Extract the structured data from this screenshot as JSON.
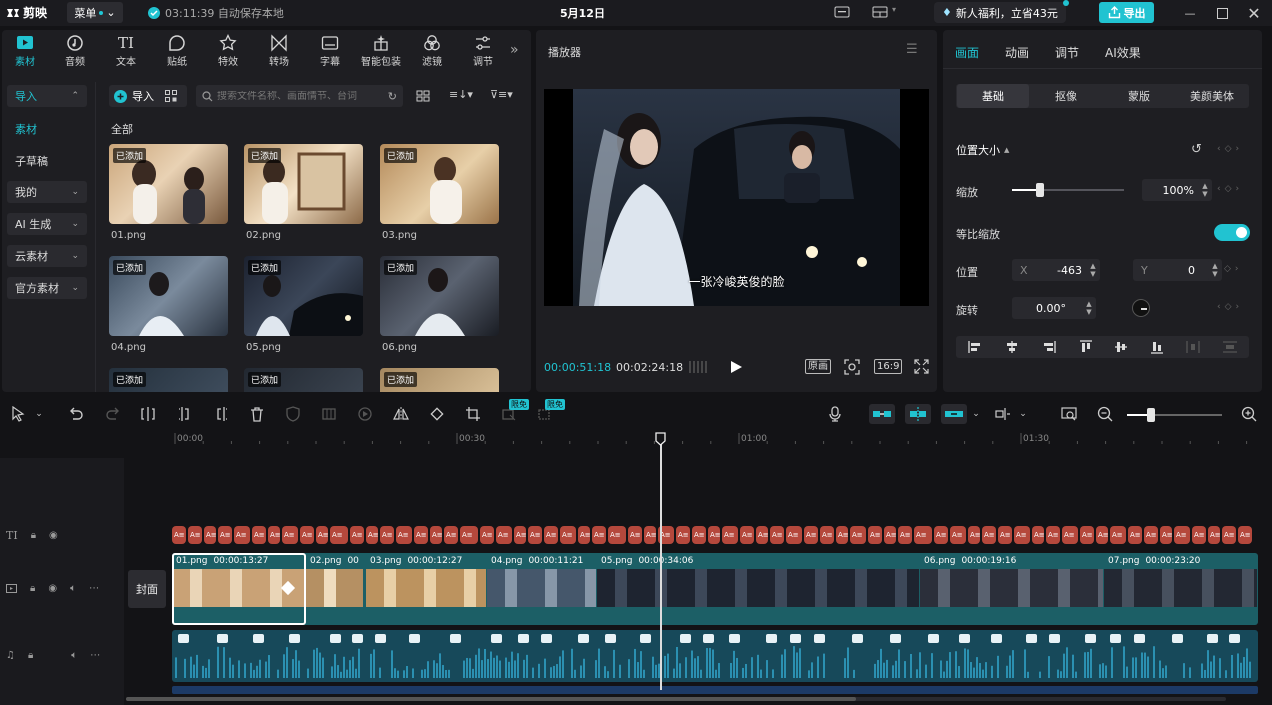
{
  "app": {
    "name": "剪映",
    "menu_label": "菜单",
    "save_status": "03:11:39 自动保存本地",
    "date": "5月12日",
    "promo": "新人福利，立省43元",
    "export_label": "导出"
  },
  "colors": {
    "accent": "#21c3d1",
    "text_clip": "#b5483c",
    "video_track": "#1c5f66",
    "audio_track": "#17495a"
  },
  "tools": [
    {
      "label": "素材",
      "icon": "media-icon"
    },
    {
      "label": "音频",
      "icon": "audio-icon"
    },
    {
      "label": "文本",
      "icon": "text-icon"
    },
    {
      "label": "贴纸",
      "icon": "sticker-icon"
    },
    {
      "label": "特效",
      "icon": "effects-icon"
    },
    {
      "label": "转场",
      "icon": "transition-icon"
    },
    {
      "label": "字幕",
      "icon": "subtitle-icon"
    },
    {
      "label": "智能包装",
      "icon": "smart-pack-icon"
    },
    {
      "label": "滤镜",
      "icon": "filter-icon"
    },
    {
      "label": "调节",
      "icon": "adjust-icon"
    }
  ],
  "left_nav": [
    {
      "label": "导入",
      "type": "box-active"
    },
    {
      "label": "素材",
      "type": "selected"
    },
    {
      "label": "子草稿",
      "type": "plain"
    },
    {
      "label": "我的",
      "type": "box"
    },
    {
      "label": "AI 生成",
      "type": "box"
    },
    {
      "label": "云素材",
      "type": "box"
    },
    {
      "label": "官方素材",
      "type": "box"
    }
  ],
  "media": {
    "import_label": "导入",
    "search_placeholder": "搜索文件名称、画面情节、台词",
    "section_title": "全部",
    "added_tag": "已添加",
    "items": [
      "01.png",
      "02.png",
      "03.png",
      "04.png",
      "05.png",
      "06.png"
    ]
  },
  "player": {
    "title": "播放器",
    "subtitle": "一张冷峻英俊的脸",
    "current_time": "00:00:51:18",
    "total_time": "00:02:24:18",
    "original_label": "原画",
    "ratio": "16:9"
  },
  "inspector": {
    "tabs": [
      "画面",
      "动画",
      "调节",
      "AI效果"
    ],
    "subtabs": [
      "基础",
      "抠像",
      "蒙版",
      "美颜美体"
    ],
    "section_title": "位置大小",
    "scale_label": "缩放",
    "scale_value": "100%",
    "scale_level": 0.25,
    "uniform_label": "等比缩放",
    "position_label": "位置",
    "x_label": "X",
    "x_value": "-463",
    "y_label": "Y",
    "y_value": "0",
    "rotate_label": "旋转",
    "rotate_value": "0.00°"
  },
  "toolbar": {
    "free_badge": "限免"
  },
  "timeline": {
    "ruler": [
      "00:00",
      "00:30",
      "01:00",
      "01:30"
    ],
    "cover_label": "封面",
    "clips": [
      {
        "name": "01.png",
        "duration": "00:00:13:27"
      },
      {
        "name": "02.png",
        "duration": "00"
      },
      {
        "name": "03.png",
        "duration": "00:00:12:27"
      },
      {
        "name": "04.png",
        "duration": "00:00:11:21"
      },
      {
        "name": "05.png",
        "duration": "00:00:34:06"
      },
      {
        "name": "06.png",
        "duration": "00:00:19:16"
      },
      {
        "name": "07.png",
        "duration": "00:00:23:20"
      }
    ],
    "text_clip_label": "A"
  }
}
